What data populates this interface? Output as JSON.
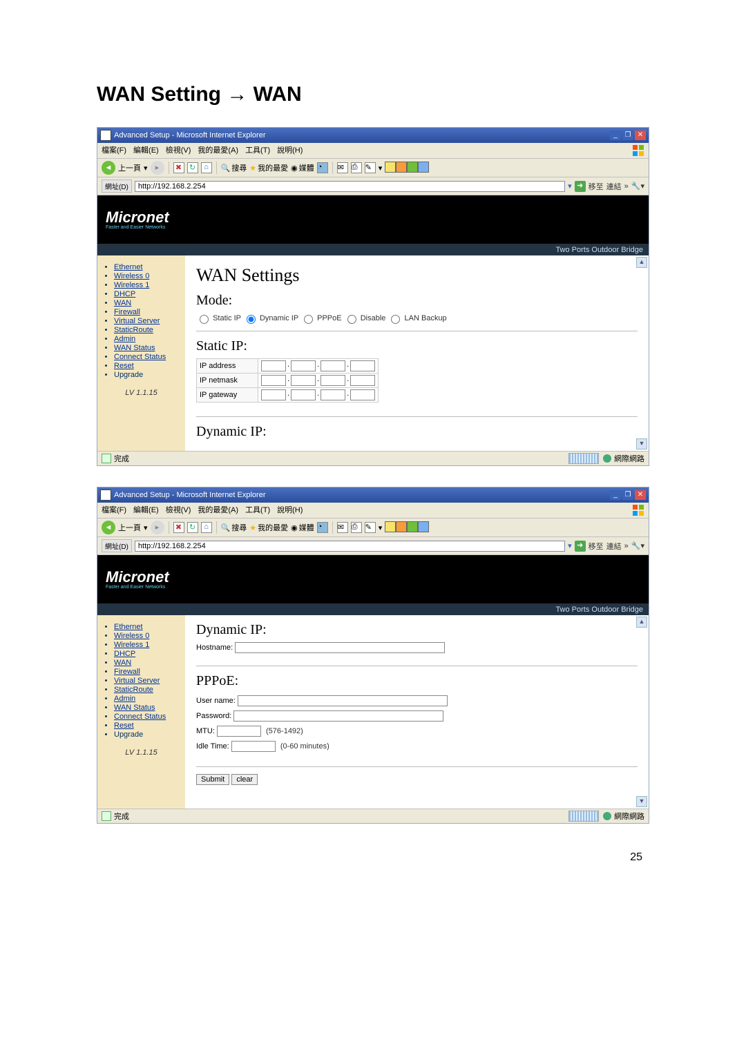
{
  "doc": {
    "title": "WAN Setting → WAN",
    "page_number": "25"
  },
  "browser": {
    "window_title": "Advanced Setup - Microsoft Internet Explorer",
    "menu": [
      "檔案(F)",
      "編輯(E)",
      "檢視(V)",
      "我的最愛(A)",
      "工具(T)",
      "說明(H)"
    ],
    "toolbar": {
      "back": "上一頁",
      "search": "搜尋",
      "favorites": "我的最愛",
      "media": "媒體"
    },
    "address": {
      "label": "網址(D)",
      "url": "http://192.168.2.254",
      "go": "移至",
      "links": "連結"
    },
    "status": {
      "done": "完成",
      "zone": "網際網路"
    }
  },
  "micronet": {
    "logo": "Micronet",
    "sub": "Faster and Easier Networks",
    "banner_right": "Two Ports Outdoor Bridge"
  },
  "sidebar": {
    "items": [
      "Ethernet",
      "Wireless 0",
      "Wireless 1",
      "DHCP",
      "WAN",
      "Firewall",
      "Virtual Server",
      "StaticRoute",
      "Admin",
      "WAN Status",
      "Connect Status",
      "Reset",
      "Upgrade"
    ],
    "version": "LV 1.1.15"
  },
  "panel1": {
    "heading": "WAN Settings",
    "mode_label": "Mode:",
    "radios": [
      "Static IP",
      "Dynamic IP",
      "PPPoE",
      "Disable",
      "LAN Backup"
    ],
    "static_heading": "Static IP:",
    "rows": {
      "ip": "IP address",
      "netmask": "IP netmask",
      "gateway": "IP gateway"
    },
    "dynamic_heading": "Dynamic IP:"
  },
  "panel2": {
    "dynamic_heading": "Dynamic IP:",
    "hostname_label": "Hostname:",
    "pppoe_heading": "PPPoE:",
    "username_label": "User name:",
    "password_label": "Password:",
    "mtu_label": "MTU:",
    "mtu_hint": "(576-1492)",
    "idle_label": "Idle Time:",
    "idle_hint": "(0-60 minutes)",
    "submit": "Submit",
    "clear": "clear"
  }
}
